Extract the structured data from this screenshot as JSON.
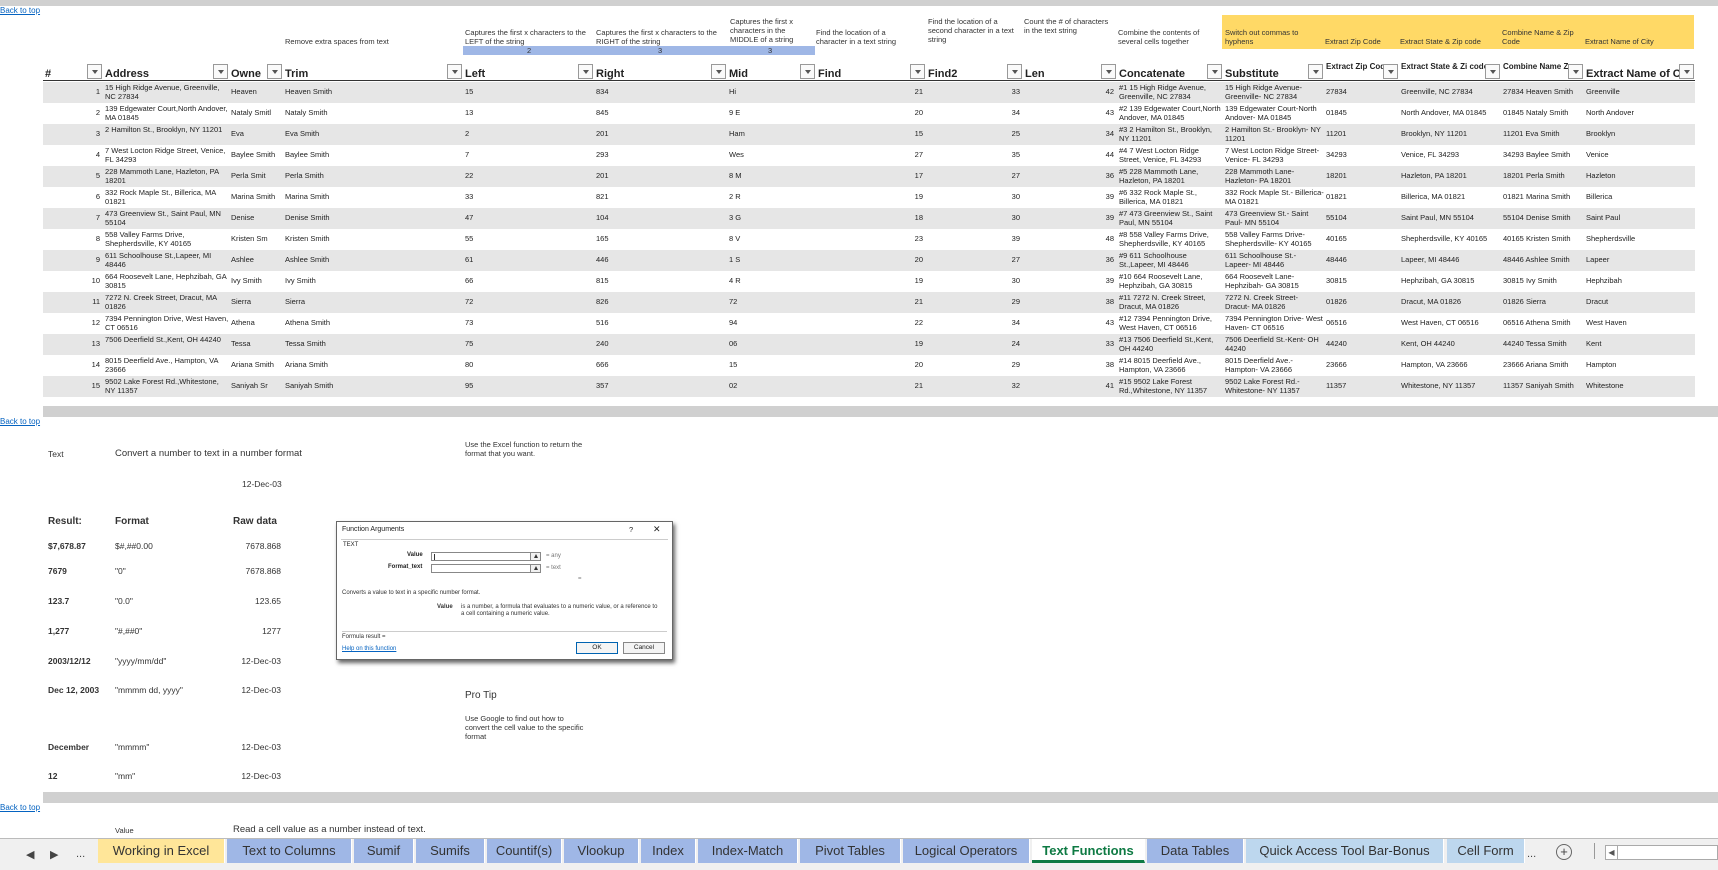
{
  "links": {
    "back_to_top": "Back to top"
  },
  "descriptions": {
    "trim": "Remove extra spaces from text",
    "left": "Captures the first x characters to the LEFT of the string",
    "right": "Captures the first x characters to the RIGHT of the string",
    "mid": "Captures the first x characters in the MIDDLE of a string",
    "find": "Find the location of a character in a text string",
    "find2": "Find the location of a second character in a text string",
    "len": "Count the # of characters in the text string",
    "concatenate": "Combine the contents of several cells together",
    "substitute": "Switch out commas to hyphens",
    "zip": "Extract Zip Code",
    "statezip": "Extract State & Zip code",
    "namezip": "Combine Name & Zip Code",
    "city": "Extract Name of City"
  },
  "char_counts": {
    "left": "2",
    "right": "3",
    "mid": "3"
  },
  "columns": [
    "#",
    "Address",
    "Owne",
    "Trim",
    "Left",
    "Right",
    "Mid",
    "Find",
    "Find2",
    "Len",
    "Concatenate",
    "Substitute",
    "Extract Zip Code",
    "Extract State & Zi code",
    "Combine Name Zip Code",
    "Extract Name of Cit"
  ],
  "rows": [
    [
      "1",
      "15 High Ridge Avenue, Greenville, NC 27834",
      "Heaven",
      "Heaven Smith",
      "15",
      "834",
      "Hi",
      "21",
      "33",
      "42",
      "#1 15 High Ridge Avenue, Greenville, NC 27834",
      "15 High Ridge Avenue- Greenville- NC 27834",
      "27834",
      "Greenville, NC 27834",
      "27834 Heaven Smith",
      "Greenville"
    ],
    [
      "2",
      "139 Edgewater Court,North Andover, MA 01845",
      "Nataly  Smitl",
      "Nataly Smith",
      "13",
      "845",
      "9 E",
      "20",
      "34",
      "43",
      "#2 139 Edgewater Court,North Andover, MA 01845",
      "139 Edgewater Court-North Andover- MA 01845",
      "01845",
      "North Andover, MA 01845",
      "01845 Nataly Smith",
      "North Andover"
    ],
    [
      "3",
      "2 Hamilton St., Brooklyn, NY 11201",
      "Eva",
      "Eva Smith",
      "2",
      "201",
      "Ham",
      "15",
      "25",
      "34",
      "#3 2 Hamilton St., Brooklyn, NY 11201",
      "2 Hamilton St.- Brooklyn- NY 11201",
      "11201",
      "Brooklyn, NY 11201",
      "11201 Eva Smith",
      "Brooklyn"
    ],
    [
      "4",
      "7 West Locton Ridge Street, Venice, FL 34293",
      "Baylee  Smith",
      "Baylee Smith",
      "7",
      "293",
      "Wes",
      "27",
      "35",
      "44",
      "#4 7 West Locton Ridge Street, Venice, FL 34293",
      "7 West Locton Ridge Street- Venice- FL 34293",
      "34293",
      "Venice, FL 34293",
      "34293 Baylee Smith",
      "Venice"
    ],
    [
      "5",
      "228 Mammoth Lane, Hazleton, PA 18201",
      "Perla    Smit",
      "Perla Smith",
      "22",
      "201",
      "8 M",
      "17",
      "27",
      "36",
      "#5 228 Mammoth Lane, Hazleton, PA 18201",
      "228 Mammoth Lane- Hazleton- PA 18201",
      "18201",
      "Hazleton, PA 18201",
      "18201 Perla Smith",
      "Hazleton"
    ],
    [
      "6",
      "332 Rock Maple St., Billerica, MA 01821",
      "Marina Smith",
      "Marina Smith",
      "33",
      "821",
      "2 R",
      "19",
      "30",
      "39",
      "#6 332 Rock Maple St., Billerica, MA 01821",
      "332 Rock Maple St.- Billerica- MA 01821",
      "01821",
      "Billerica, MA 01821",
      "01821 Marina Smith",
      "Billerica"
    ],
    [
      "7",
      "473 Greenview St., Saint Paul, MN 55104",
      "Denise",
      "Denise Smith",
      "47",
      "104",
      "3 G",
      "18",
      "30",
      "39",
      "#7 473 Greenview St., Saint Paul, MN 55104",
      "473 Greenview St.- Saint Paul- MN 55104",
      "55104",
      "Saint Paul, MN 55104",
      "55104 Denise Smith",
      "Saint Paul"
    ],
    [
      "8",
      "558 Valley Farms Drive, Shepherdsville, KY 40165",
      "Kristen    Sm",
      "Kristen Smith",
      "55",
      "165",
      "8 V",
      "23",
      "39",
      "48",
      "#8 558 Valley Farms Drive, Shepherdsville, KY 40165",
      "558 Valley Farms Drive- Shepherdsville- KY 40165",
      "40165",
      "Shepherdsville, KY 40165",
      "40165 Kristen Smith",
      "Shepherdsville"
    ],
    [
      "9",
      "611 Schoolhouse St.,Lapeer, MI 48446",
      "Ashlee",
      "Ashlee Smith",
      "61",
      "446",
      "1 S",
      "20",
      "27",
      "36",
      "#9 611 Schoolhouse St.,Lapeer, MI 48446",
      "611 Schoolhouse St.- Lapeer- MI 48446",
      "48446",
      "Lapeer, MI 48446",
      "48446 Ashlee Smith",
      "Lapeer"
    ],
    [
      "10",
      "664 Roosevelt Lane, Hephzibah, GA 30815",
      "Ivy Smith",
      "Ivy Smith",
      "66",
      "815",
      "4 R",
      "19",
      "30",
      "39",
      "#10 664 Roosevelt Lane, Hephzibah, GA 30815",
      "664 Roosevelt Lane- Hephzibah- GA 30815",
      "30815",
      "Hephzibah, GA 30815",
      "30815 Ivy Smith",
      "Hephzibah"
    ],
    [
      "11",
      "7272 N. Creek Street, Dracut, MA 01826",
      "Sierra",
      "Sierra",
      "72",
      "826",
      "72",
      "21",
      "29",
      "38",
      "#11 7272 N. Creek Street, Dracut, MA 01826",
      "7272 N. Creek Street- Dracut- MA 01826",
      "01826",
      "Dracut, MA 01826",
      "01826 Sierra",
      "Dracut"
    ],
    [
      "12",
      "7394 Pennington Drive, West Haven, CT 06516",
      "Athena",
      "Athena Smith",
      "73",
      "516",
      "94",
      "22",
      "34",
      "43",
      "#12 7394 Pennington Drive, West Haven, CT 06516",
      "7394 Pennington Drive- West Haven- CT 06516",
      "06516",
      "West Haven, CT 06516",
      "06516 Athena Smith",
      "West Haven"
    ],
    [
      "13",
      "7506 Deerfield St.,Kent, OH 44240",
      "Tessa",
      "Tessa Smith",
      "75",
      "240",
      "06",
      "19",
      "24",
      "33",
      "#13 7506 Deerfield St.,Kent, OH 44240",
      "7506 Deerfield St.-Kent- OH 44240",
      "44240",
      "Kent, OH 44240",
      "44240 Tessa Smith",
      "Kent"
    ],
    [
      "14",
      "8015 Deerfield Ave., Hampton, VA 23666",
      "Ariana  Smith",
      "Ariana Smith",
      "80",
      "666",
      "15",
      "20",
      "29",
      "38",
      "#14 8015 Deerfield Ave., Hampton, VA 23666",
      "8015 Deerfield Ave.- Hampton- VA 23666",
      "23666",
      "Hampton, VA 23666",
      "23666 Ariana Smith",
      "Hampton"
    ],
    [
      "15",
      "9502 Lake Forest Rd.,Whitestone, NY 11357",
      "Saniyah    Sr",
      "Saniyah Smith",
      "95",
      "357",
      "02",
      "21",
      "32",
      "41",
      "#15 9502 Lake Forest Rd.,Whitestone, NY 11357",
      "9502 Lake Forest Rd.- Whitestone- NY 11357",
      "11357",
      "Whitestone, NY 11357",
      "11357 Saniyah Smith",
      "Whitestone"
    ]
  ],
  "text_section": {
    "label": "Text",
    "desc": "Convert a number to text in a number format",
    "date_top": "12-Dec-03",
    "note": "Use the Excel function to return the format that you want.",
    "headers": {
      "result": "Result:",
      "format": "Format",
      "raw": "Raw data"
    },
    "examples": [
      {
        "result": "$7,678.87",
        "format": "$#,##0.00",
        "raw": "7678.868"
      },
      {
        "result": "7679",
        "format": "\"0\"",
        "raw": "7678.868"
      },
      {
        "result": "123.7",
        "format": "\"0.0\"",
        "raw": "123.65"
      },
      {
        "result": "1,277",
        "format": "\"#,##0\"",
        "raw": "1277"
      },
      {
        "result": "2003/12/12",
        "format": "\"yyyy/mm/dd\"",
        "raw": "12-Dec-03"
      },
      {
        "result": "Dec 12, 2003",
        "format": "\"mmmm dd, yyyy\"",
        "raw": "12-Dec-03"
      },
      {
        "result": "December",
        "format": "\"mmmm\"",
        "raw": "12-Dec-03"
      },
      {
        "result": "12",
        "format": "\"mm\"",
        "raw": "12-Dec-03"
      }
    ],
    "pro_tip": "Pro Tip",
    "pro_tip_text": "Use Google to find out how to convert the cell value to the specific format"
  },
  "dialog": {
    "title": "Function Arguments",
    "help_glyph": "?",
    "close_glyph": "✕",
    "func": "TEXT",
    "value_label": "Value",
    "format_label": "Format_text",
    "value_result": "=  any",
    "format_result": "=  text",
    "eq": "=",
    "description": "Converts a value to text in a specific number format.",
    "arg_name": "Value",
    "arg_desc": "is a number, a formula that evaluates to a numeric value, or a reference to a cell containing a numeric value.",
    "formula_result": "Formula result =",
    "help_link": "Help on this function",
    "ok": "OK",
    "cancel": "Cancel"
  },
  "value_section": {
    "label": "Value",
    "desc": "Read a cell value as a number instead of text."
  },
  "tabs": {
    "nav_prev": "◀",
    "nav_next": "▶",
    "ellipsis": "...",
    "items": [
      "Working in Excel",
      "Text to Columns",
      "Sumif",
      "Sumifs",
      "Countif(s)",
      "Vlookup",
      "Index",
      "Index-Match",
      "Pivot Tables",
      "Logical Operators",
      "Text Functions",
      "Data Tables",
      "Quick Access Tool Bar-Bonus",
      "Cell Form"
    ],
    "more": "...",
    "add": "+",
    "scroll_left": "◀"
  },
  "colors": {
    "accent": "#0e7a43",
    "yellow": "#ffd966",
    "blue": "#9fb7e6"
  }
}
